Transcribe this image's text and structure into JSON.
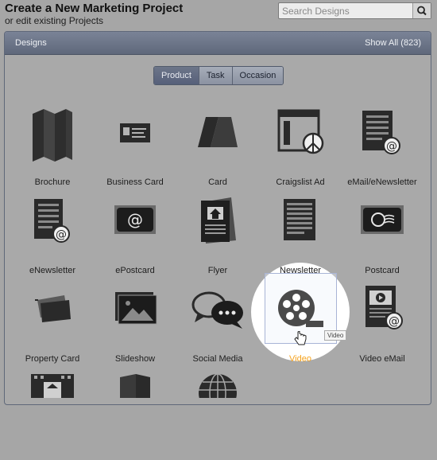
{
  "header": {
    "title": "Create a New Marketing Project",
    "subtitle": "or edit existing Projects"
  },
  "search": {
    "placeholder": "Search Designs",
    "icon": "search-icon"
  },
  "panel": {
    "title": "Designs",
    "show_all": "Show All (823)"
  },
  "tabs": [
    {
      "label": "Product",
      "active": true
    },
    {
      "label": "Task",
      "active": false
    },
    {
      "label": "Occasion",
      "active": false
    }
  ],
  "designs": [
    {
      "label": "Brochure",
      "icon": "brochure-icon"
    },
    {
      "label": "Business Card",
      "icon": "business-card-icon"
    },
    {
      "label": "Card",
      "icon": "card-icon"
    },
    {
      "label": "Craigslist Ad",
      "icon": "craigslist-ad-icon"
    },
    {
      "label": "eMail/eNewsletter",
      "icon": "email-newsletter-icon"
    },
    {
      "label": "eNewsletter",
      "icon": "enewsletter-icon"
    },
    {
      "label": "ePostcard",
      "icon": "epostcard-icon"
    },
    {
      "label": "Flyer",
      "icon": "flyer-icon"
    },
    {
      "label": "Newsletter",
      "icon": "newsletter-icon"
    },
    {
      "label": "Postcard",
      "icon": "postcard-icon"
    },
    {
      "label": "Property Card",
      "icon": "property-card-icon"
    },
    {
      "label": "Slideshow",
      "icon": "slideshow-icon"
    },
    {
      "label": "Social Media",
      "icon": "social-media-icon"
    },
    {
      "label": "Video",
      "icon": "video-icon",
      "highlighted": true
    },
    {
      "label": "Video eMail",
      "icon": "video-email-icon"
    }
  ],
  "tooltip": "Video",
  "colors": {
    "accent": "#f5a21d",
    "header_bar": "#69728a",
    "icon_dark": "#262626",
    "icon_mid": "#4a4a4a"
  }
}
